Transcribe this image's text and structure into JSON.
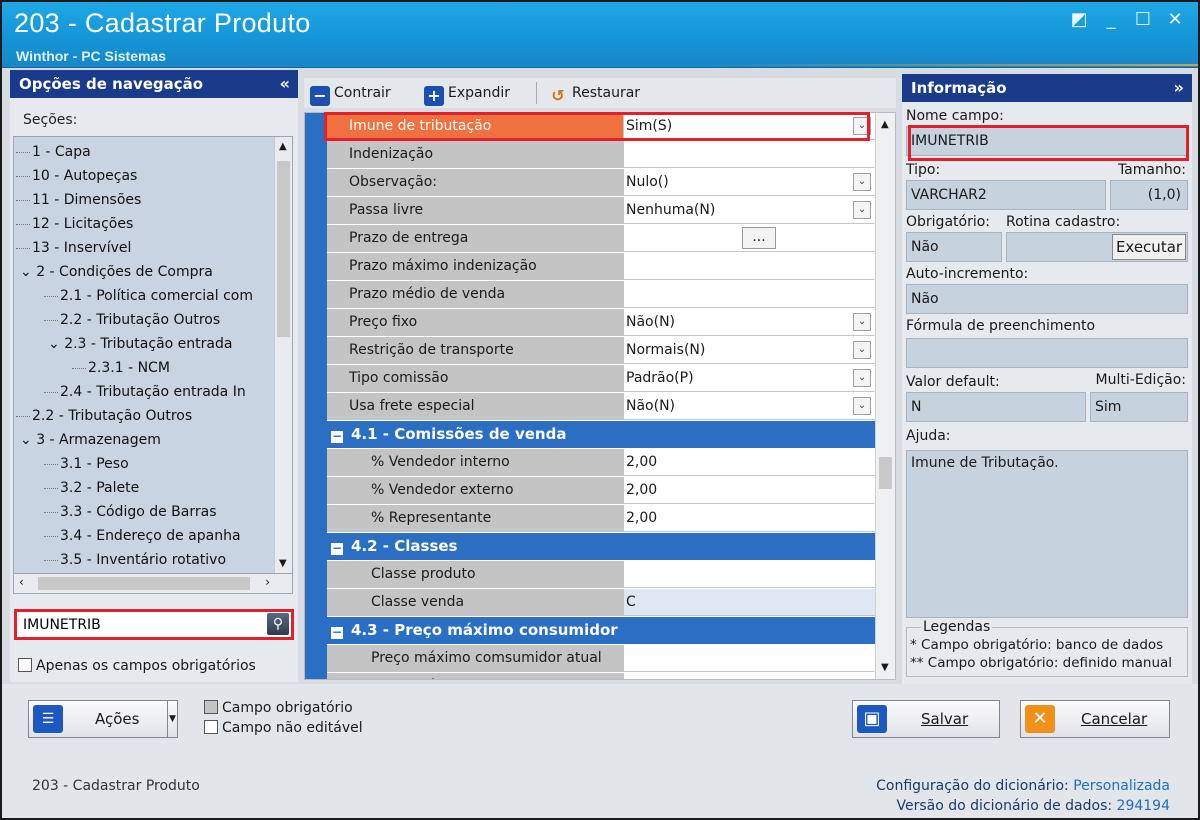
{
  "window": {
    "title": "203 - Cadastrar  Produto",
    "subtitle": "Winthor - PC Sistemas"
  },
  "nav": {
    "header": "Opções de navegação",
    "collapse": "«",
    "sections_label": "Seções:",
    "tree": [
      {
        "label": "1 - Capa",
        "level": 0
      },
      {
        "label": "10 - Autopeças",
        "level": 0
      },
      {
        "label": "11 - Dimensões",
        "level": 0
      },
      {
        "label": "12 - Licitações",
        "level": 0
      },
      {
        "label": "13 - Inservível",
        "level": 0
      },
      {
        "label": "2 - Condições de Compra",
        "level": 0,
        "expanded": true
      },
      {
        "label": "2.1 - Política comercial com",
        "level": 1
      },
      {
        "label": "2.2 - Tributação Outros",
        "level": 1
      },
      {
        "label": "2.3 - Tributação entrada",
        "level": 1,
        "expanded": true
      },
      {
        "label": "2.3.1 - NCM",
        "level": 2
      },
      {
        "label": "2.4 - Tributação entrada In",
        "level": 1
      },
      {
        "label": "2.2 - Tributação Outros",
        "level": 0
      },
      {
        "label": "3 - Armazenagem",
        "level": 0,
        "expanded": true
      },
      {
        "label": "3.1 - Peso",
        "level": 1
      },
      {
        "label": "3.2 - Palete",
        "level": 1
      },
      {
        "label": "3.3 - Código de Barras",
        "level": 1
      },
      {
        "label": "3.4 - Endereço de apanha",
        "level": 1
      },
      {
        "label": "3.5 - Inventário rotativo",
        "level": 1
      }
    ],
    "search_value": "IMUNETRIB",
    "only_required_label": "Apenas os campos obrigatórios"
  },
  "toolbar": {
    "contrair": "Contrair",
    "expandir": "Expandir",
    "restaurar": "Restaurar"
  },
  "grid": {
    "rows": [
      {
        "label": "Imune de tributação",
        "value": "Sim(S)",
        "dropdown": true,
        "highlight": true
      },
      {
        "label": "Indenização",
        "value": ""
      },
      {
        "label": "Observação:",
        "value": "Nulo()",
        "dropdown": true
      },
      {
        "label": "Passa livre",
        "value": "Nenhuma(N)",
        "dropdown": true
      },
      {
        "label": "Prazo de entrega",
        "value": "",
        "ellipsis": "..."
      },
      {
        "label": "Prazo máximo indenização",
        "value": ""
      },
      {
        "label": "Prazo médio de venda",
        "value": ""
      },
      {
        "label": "Preço fixo",
        "value": "Não(N)",
        "dropdown": true
      },
      {
        "label": "Restrição de transporte",
        "value": "Normais(N)",
        "dropdown": true
      },
      {
        "label": "Tipo comissão",
        "value": "Padrão(P)",
        "dropdown": true
      },
      {
        "label": "Usa frete especial",
        "value": "Não(N)",
        "dropdown": true
      }
    ],
    "sections": [
      {
        "title": "4.1 - Comissões de venda",
        "rows": [
          {
            "label": "% Vendedor interno",
            "value": "2,00"
          },
          {
            "label": "% Vendedor externo",
            "value": "2,00"
          },
          {
            "label": "% Representante",
            "value": "2,00"
          }
        ]
      },
      {
        "title": "4.2 - Classes",
        "rows": [
          {
            "label": "Classe produto",
            "value": ""
          },
          {
            "label": "Classe venda",
            "value": "C",
            "alt": true
          }
        ]
      },
      {
        "title": "4.3 - Preço máximo consumidor",
        "rows": [
          {
            "label": "Preço máximo comsumidor atual",
            "value": ""
          },
          {
            "label": "Preço máximo consumidor futuro",
            "value": ""
          }
        ]
      }
    ]
  },
  "info": {
    "header": "Informação",
    "expand": "»",
    "nome_campo_label": "Nome campo:",
    "nome_campo": "IMUNETRIB",
    "tipo_label": "Tipo:",
    "tipo": "VARCHAR2",
    "tamanho_label": "Tamanho:",
    "tamanho": "(1,0)",
    "obrigatorio_label": "Obrigatório:",
    "obrigatorio": "Não",
    "rotina_label": "Rotina cadastro:",
    "executar": "Executar",
    "auto_label": "Auto-incremento:",
    "auto": "Não",
    "formula_label": "Fórmula de preenchimento",
    "formula": "",
    "default_label": "Valor default:",
    "default": "N",
    "multi_label": "Multi-Edição:",
    "multi": "Sim",
    "ajuda_label": "Ajuda:",
    "ajuda": "Imune de Tributação.",
    "legend_title": "Legendas",
    "legend_1": "* Campo obrigatório: banco de dados",
    "legend_2": "** Campo obrigatório: definido manual"
  },
  "footer": {
    "acoes": "Ações",
    "legend_required": "Campo obrigatório",
    "legend_readonly": "Campo não editável",
    "salvar": "Salvar",
    "cancelar": "Cancelar",
    "status_left": "203 - Cadastrar  Produto",
    "config_label": "Configuração do dicionário:",
    "config_value": "Personalizada",
    "version_label": "Versão do dicionário de dados:",
    "version_value": "294194"
  },
  "colors": {
    "title_bar": "#1a9ee0",
    "panel_header": "#1a3a8a",
    "section_header": "#2a6fc4",
    "highlight_row": "#f07040",
    "red_frame": "#e0202a"
  }
}
